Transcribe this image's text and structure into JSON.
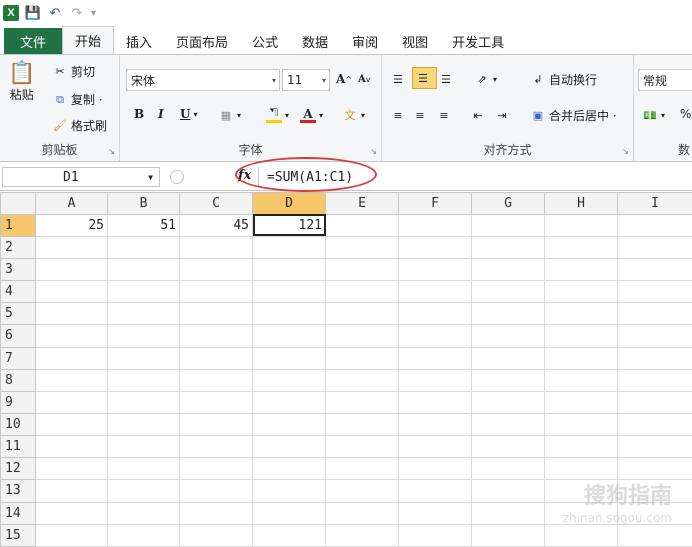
{
  "quick_access": {
    "excel_icon": "X",
    "save_icon": "save",
    "undo_icon": "undo",
    "redo_icon": "redo"
  },
  "tabs": [
    "文件",
    "开始",
    "插入",
    "页面布局",
    "公式",
    "数据",
    "审阅",
    "视图",
    "开发工具"
  ],
  "ribbon": {
    "clipboard": {
      "paste": "粘贴",
      "cut": "剪切",
      "copy": "复制 ·",
      "format_painter": "格式刷",
      "label": "剪贴板"
    },
    "font": {
      "name": "宋体",
      "size": "11",
      "grow": "A",
      "shrink": "A",
      "bold": "B",
      "italic": "I",
      "underline": "U",
      "label": "字体"
    },
    "alignment": {
      "wrap": "自动换行",
      "merge": "合并后居中 ·",
      "label": "对齐方式"
    },
    "number": {
      "format": "常规",
      "percent": "%",
      "label": "数"
    }
  },
  "formula_bar": {
    "name_box": "D1",
    "fx": "fx",
    "formula": "=SUM(A1:C1)"
  },
  "columns": [
    "A",
    "B",
    "C",
    "D",
    "E",
    "F",
    "G",
    "H",
    "I"
  ],
  "rows": [
    "1",
    "2",
    "3",
    "4",
    "5",
    "6",
    "7",
    "8",
    "9",
    "10",
    "11",
    "12",
    "13",
    "14",
    "15"
  ],
  "cells": {
    "A1": "25",
    "B1": "51",
    "C1": "45",
    "D1": "121"
  },
  "watermark": {
    "line1": "搜狗指南",
    "line2": "zhinan.sogou.com"
  },
  "colors": {
    "file_tab": "#217346",
    "selection": "#f5c66a",
    "annotation_oval": "#d93c3c"
  }
}
